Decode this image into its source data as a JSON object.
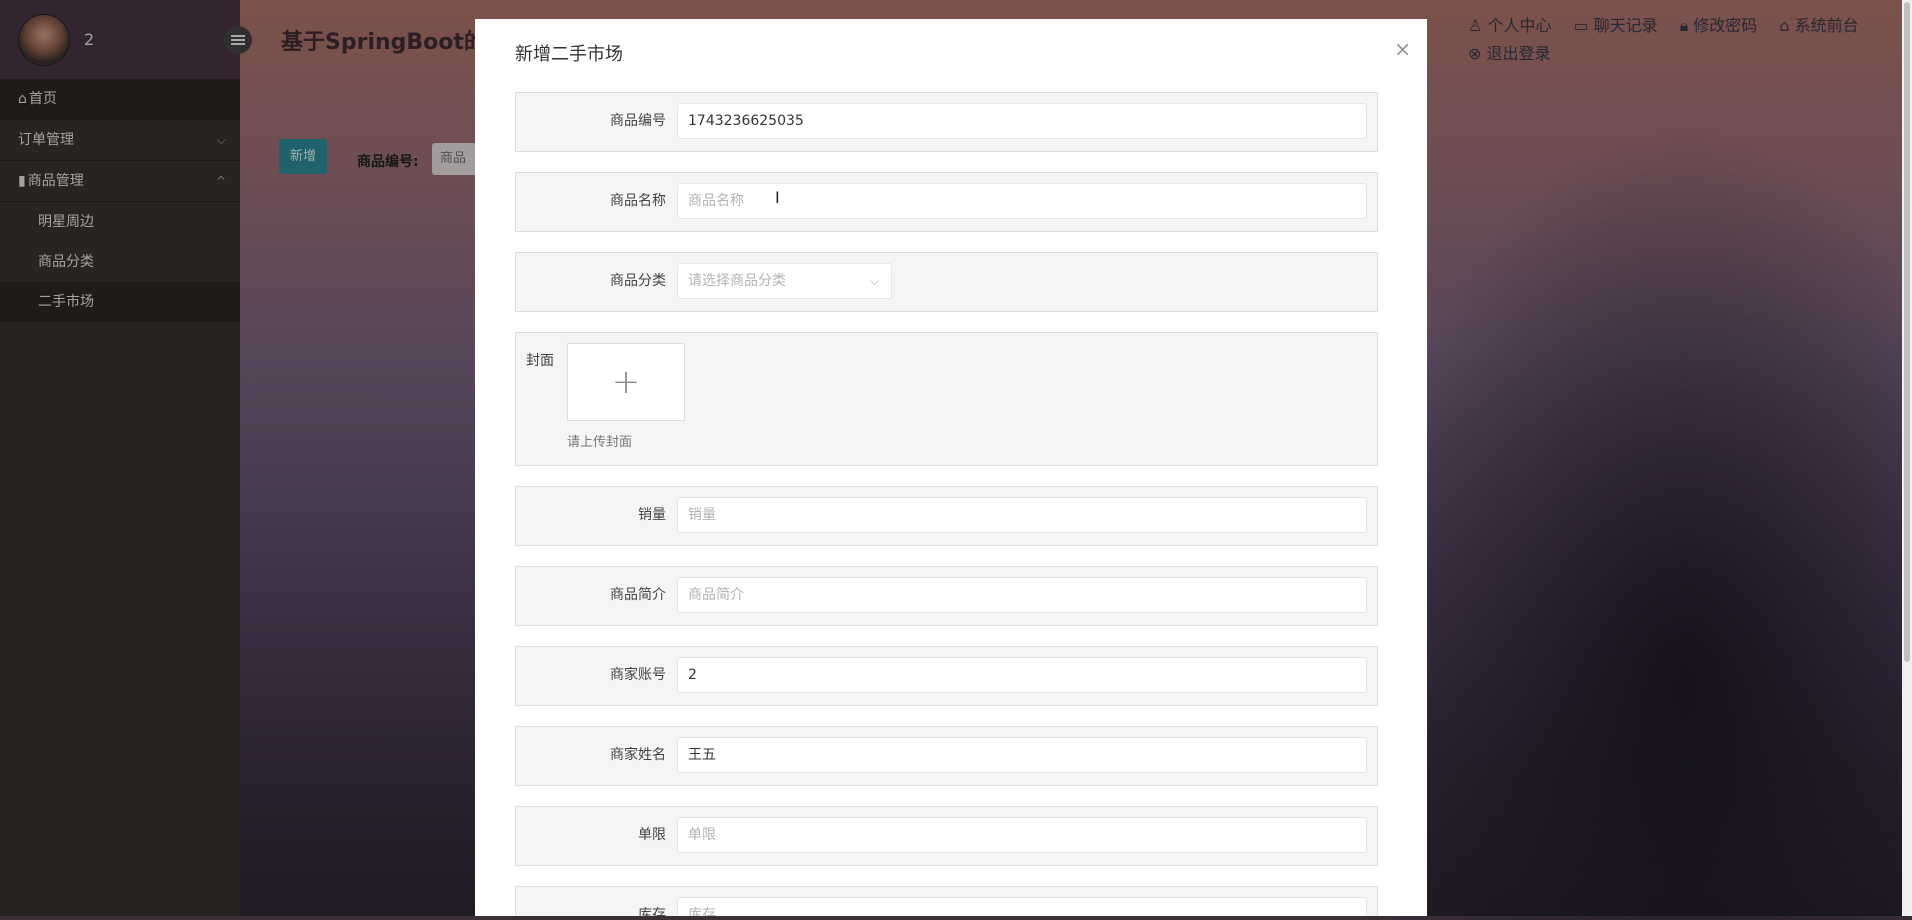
{
  "sidebar": {
    "username": "2",
    "menu": [
      {
        "label": "首页",
        "icon": "home-icon"
      },
      {
        "label": "订单管理",
        "icon": "",
        "chevron": "chevron-down-icon"
      },
      {
        "label": "商品管理",
        "icon": "book-icon",
        "chevron": "chevron-up-icon"
      }
    ],
    "submenu": [
      {
        "label": "明星周边"
      },
      {
        "label": "商品分类"
      },
      {
        "label": "二手市场"
      }
    ]
  },
  "header": {
    "title": "基于SpringBoot的M",
    "links_row1": [
      "个人中心",
      "聊天记录",
      "修改密码",
      "系统前台"
    ],
    "links_row2": [
      "退出登录"
    ]
  },
  "behind_toolbar": {
    "add_label": "新增",
    "search_label": "商品编号:",
    "search_placeholder": "商品"
  },
  "dialog": {
    "title": "新增二手市场",
    "close": "×",
    "fields": [
      {
        "label": "商品编号",
        "value": "1743236625035",
        "placeholder": ""
      },
      {
        "label": "商品名称",
        "value": "",
        "placeholder": "商品名称"
      },
      {
        "label": "商品分类",
        "value": "",
        "placeholder": "请选择商品分类"
      },
      {
        "label": "销量",
        "value": "",
        "placeholder": "销量"
      },
      {
        "label": "商品简介",
        "value": "",
        "placeholder": "商品简介"
      },
      {
        "label": "商家账号",
        "value": "2",
        "placeholder": ""
      },
      {
        "label": "商家姓名",
        "value": "王五",
        "placeholder": ""
      },
      {
        "label": "单限",
        "value": "",
        "placeholder": "单限"
      },
      {
        "label": "库存",
        "value": "",
        "placeholder": "库存"
      }
    ],
    "cover": {
      "label": "封面",
      "hint": "请上传封面",
      "plus": "+"
    }
  }
}
